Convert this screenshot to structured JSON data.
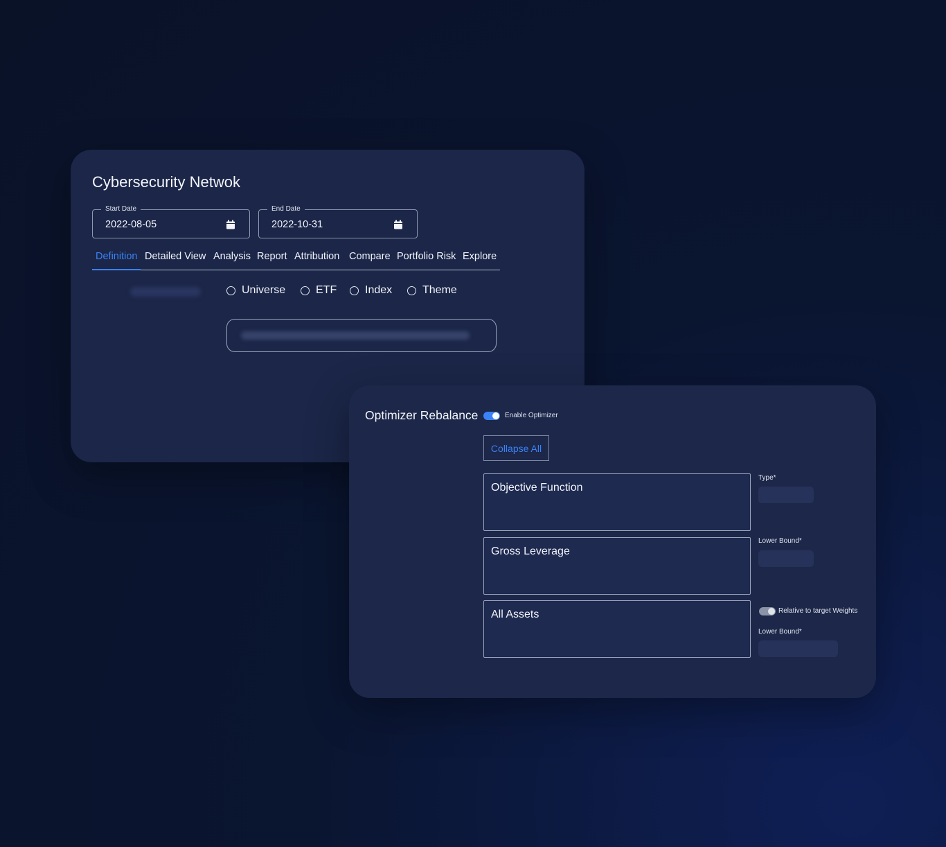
{
  "main": {
    "title": "Cybersecurity Netwok",
    "start_date": {
      "label": "Start Date",
      "value": "2022-08-05",
      "icon": "calendar-icon"
    },
    "end_date": {
      "label": "End Date",
      "value": "2022-10-31",
      "icon": "calendar-icon"
    },
    "tabs": [
      "Definition",
      "Detailed View",
      "Analysis",
      "Report",
      "Attribution",
      "Compare",
      "Portfolio Risk",
      "Explore"
    ],
    "active_tab": "Definition",
    "radios": [
      "Universe",
      "ETF",
      "Index",
      "Theme"
    ]
  },
  "optimizer": {
    "title": "Optimizer Rebalance",
    "enable_label": "Enable Optimizer",
    "enabled": true,
    "collapse_label": "Collapse All",
    "sections": [
      "Objective Function",
      "Gross Leverage",
      "All Assets"
    ],
    "type_label": "Type*",
    "lower_bound_label": "Lower Bound*",
    "relative_label": "Relative to target Weights",
    "lower_bound_label_2": "Lower Bound*"
  },
  "colors": {
    "accent": "#3b82f6",
    "card": "#1b2648",
    "background": "#0a1228"
  }
}
